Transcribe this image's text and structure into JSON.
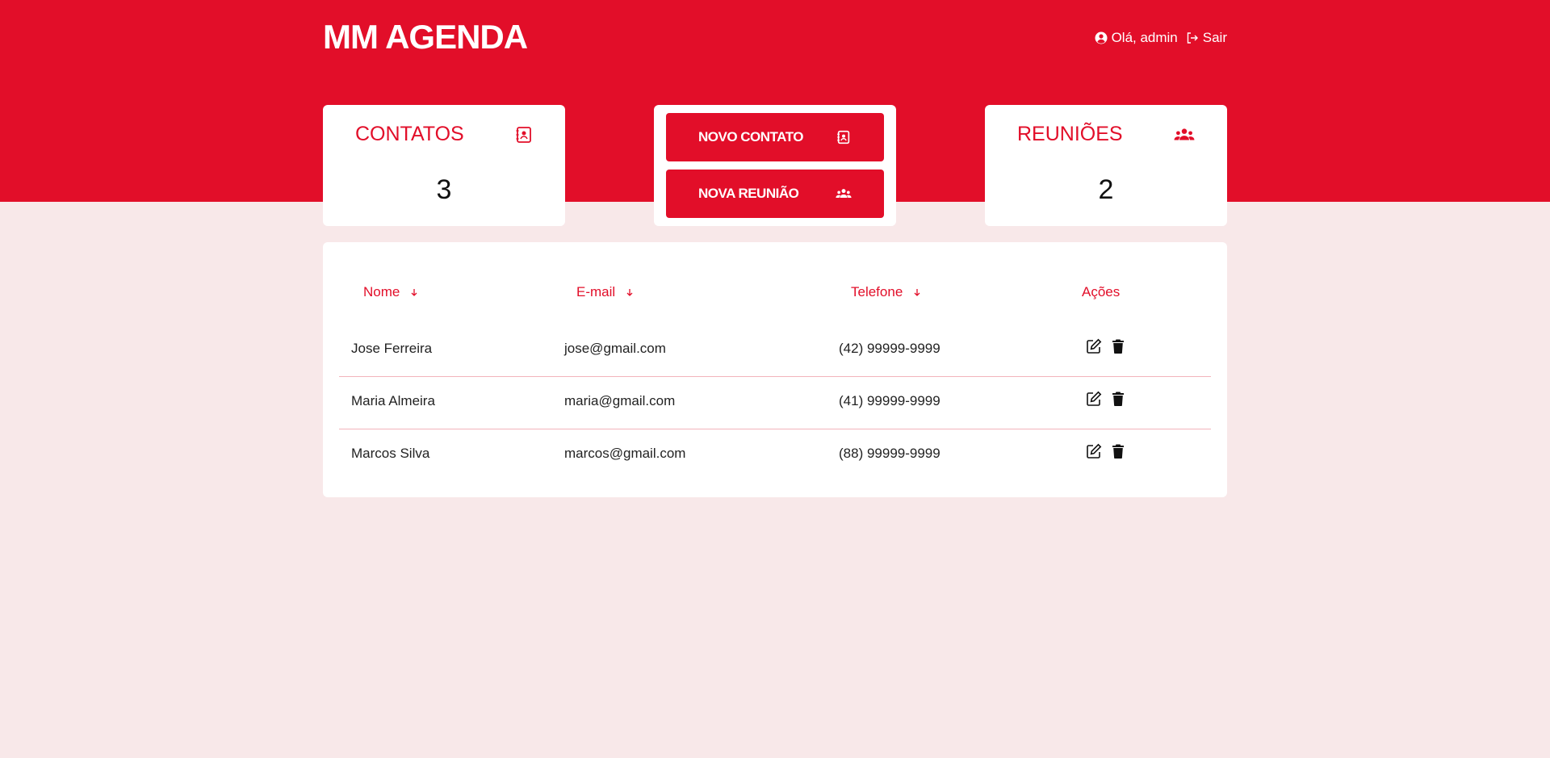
{
  "header": {
    "brand": "MM AGENDA",
    "greeting": "Olá, admin",
    "logout_label": "Sair"
  },
  "stats": {
    "contacts": {
      "title": "CONTATOS",
      "count": "3",
      "icon": "address-book-icon"
    },
    "meetings": {
      "title": "REUNIÕES",
      "count": "2",
      "icon": "users-icon"
    }
  },
  "actions": {
    "new_contact": "NOVO CONTATO",
    "new_meeting": "NOVA REUNIÃO"
  },
  "table": {
    "headers": {
      "name": "Nome",
      "email": "E-mail",
      "phone": "Telefone",
      "actions": "Ações"
    },
    "rows": [
      {
        "name": "Jose Ferreira",
        "email": "jose@gmail.com",
        "phone": "(42) 99999-9999"
      },
      {
        "name": "Maria Almeira",
        "email": "maria@gmail.com",
        "phone": "(41) 99999-9999"
      },
      {
        "name": "Marcos Silva",
        "email": "marcos@gmail.com",
        "phone": "(88) 99999-9999"
      }
    ]
  },
  "colors": {
    "brand_red": "#e20e29",
    "page_bg": "#f8e8e9",
    "row_separator": "#f3b4bc"
  }
}
